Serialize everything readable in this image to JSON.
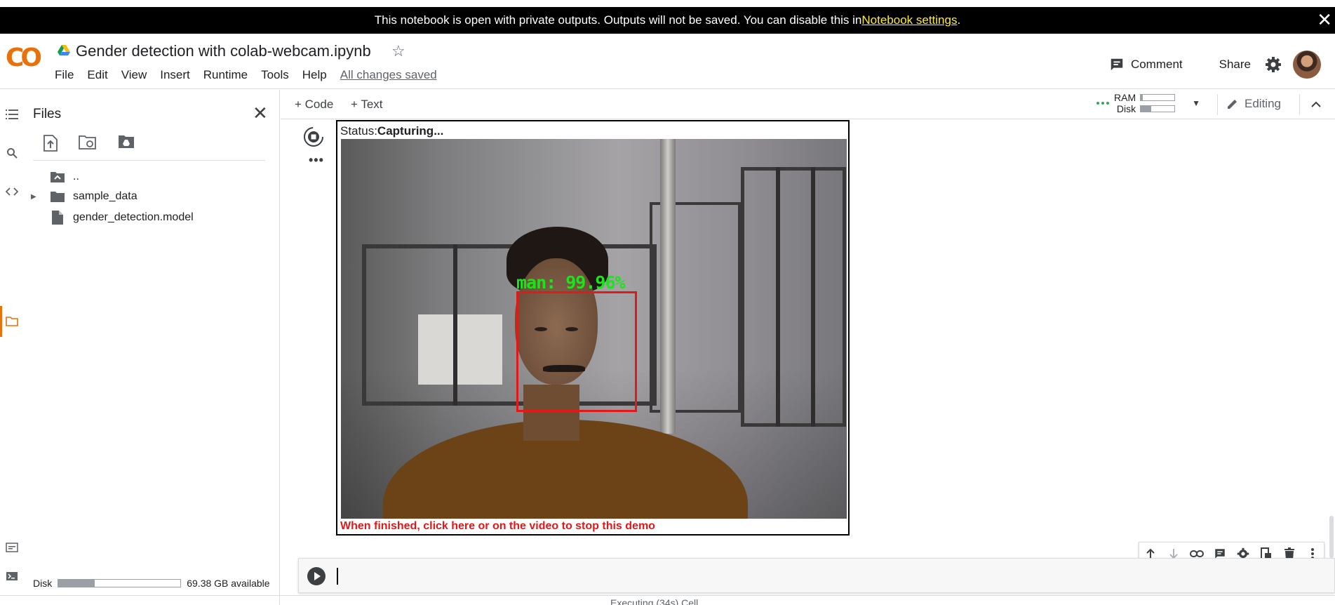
{
  "banner": {
    "text": "This notebook is open with private outputs. Outputs will not be saved. You can disable this in ",
    "link": "Notebook settings",
    "suffix": ".",
    "close": "✕"
  },
  "header": {
    "logo": "CO",
    "title": "Gender detection with colab-webcam.ipynb",
    "menu": [
      "File",
      "Edit",
      "View",
      "Insert",
      "Runtime",
      "Tools",
      "Help"
    ],
    "saved_status": "All changes saved",
    "comment_label": "Comment",
    "share_label": "Share"
  },
  "files_panel": {
    "title": "Files",
    "tree": [
      {
        "label": ".."
      },
      {
        "label": "sample_data"
      },
      {
        "label": "gender_detection.model"
      }
    ],
    "disk_label": "Disk",
    "disk_available": "69.38 GB available",
    "disk_used_fraction": 0.3
  },
  "toolbar": {
    "add_code": "+ Code",
    "add_text": "+ Text",
    "ram_label": "RAM",
    "disk_label": "Disk",
    "ram_fraction": 0.05,
    "disk_fraction": 0.3,
    "editing_label": "Editing"
  },
  "output": {
    "status_prefix": "Status:",
    "status_value": "Capturing...",
    "detection_label": "man: 99.96%",
    "finish_text": "When finished, click here or on the video to stop this demo"
  },
  "footer": {
    "status": "Executing (34s)  Cell"
  },
  "colors": {
    "accent": "#e8710a",
    "logo_yellow": "#f9ab00",
    "detection_green": "#19e619",
    "detection_red": "#e11919",
    "ram_dots": "#34a853"
  }
}
